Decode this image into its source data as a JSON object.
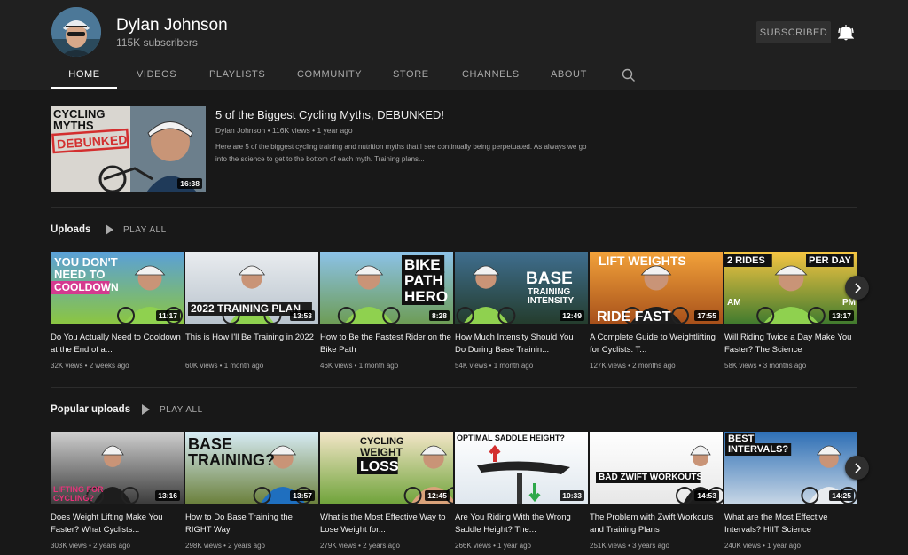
{
  "channel": {
    "name": "Dylan Johnson",
    "subscribers": "115K subscribers",
    "subscribe_label": "SUBSCRIBED"
  },
  "tabs": [
    "HOME",
    "VIDEOS",
    "PLAYLISTS",
    "COMMUNITY",
    "STORE",
    "CHANNELS",
    "ABOUT"
  ],
  "featured": {
    "title": "5 of the Biggest Cycling Myths, DEBUNKED!",
    "meta": "Dylan Johnson • 116K views • 1 year ago",
    "description": "Here are 5 of the biggest cycling training and nutrition myths that I see continually being perpetuated. As always we go into the science to get to the bottom of each myth. Training plans...",
    "duration": "16:38",
    "thumb_text": [
      "CYCLING",
      "MYTHS",
      "DEBUNKED"
    ]
  },
  "uploads": {
    "title": "Uploads",
    "play_all": "PLAY ALL",
    "videos": [
      {
        "title": "Do You Actually Need to Cooldown at the End of a...",
        "meta": "32K views • 2 weeks ago",
        "duration": "11:17",
        "thumb_text": [
          "YOU DON'T",
          "NEED TO",
          "COOLDOWN"
        ]
      },
      {
        "title": "This is How I'll Be Training in 2022",
        "meta": "60K views • 1 month ago",
        "duration": "13:53",
        "thumb_text": [
          "2022 TRAINING PLAN"
        ]
      },
      {
        "title": "How to Be the Fastest Rider on the Bike Path",
        "meta": "46K views • 1 month ago",
        "duration": "8:28",
        "thumb_text": [
          "BIKE",
          "PATH",
          "HERO"
        ]
      },
      {
        "title": "How Much Intensity Should You Do During Base Trainin...",
        "meta": "54K views • 1 month ago",
        "duration": "12:49",
        "thumb_text": [
          "BASE",
          "TRAINING",
          "INTENSITY"
        ]
      },
      {
        "title": "A Complete Guide to Weightlifting for Cyclists. T...",
        "meta": "127K views • 2 months ago",
        "duration": "17:55",
        "thumb_text": [
          "LIFT WEIGHTS",
          "RIDE FAST"
        ]
      },
      {
        "title": "Will Riding Twice a Day Make You Faster? The Science",
        "meta": "58K views • 3 months ago",
        "duration": "13:17",
        "thumb_text": [
          "2 RIDES",
          "PER DAY",
          "AM",
          "PM"
        ]
      }
    ]
  },
  "popular": {
    "title": "Popular uploads",
    "play_all": "PLAY ALL",
    "videos": [
      {
        "title": "Does Weight Lifting Make You Faster? What Cyclists...",
        "meta": "303K views • 2 years ago",
        "duration": "13:16",
        "thumb_text": [
          "LIFTING FOR",
          "CYCLING?"
        ]
      },
      {
        "title": "How to Do Base Training the RIGHT Way",
        "meta": "298K views • 2 years ago",
        "duration": "13:57",
        "thumb_text": [
          "BASE",
          "TRAINING?"
        ]
      },
      {
        "title": "What is the Most Effective Way to Lose Weight for...",
        "meta": "279K views • 2 years ago",
        "duration": "12:45",
        "thumb_text": [
          "CYCLING",
          "WEIGHT",
          "LOSS"
        ]
      },
      {
        "title": "Are You Riding With the Wrong Saddle Height? The...",
        "meta": "266K views • 1 year ago",
        "duration": "10:33",
        "thumb_text": [
          "OPTIMAL SADDLE HEIGHT?"
        ]
      },
      {
        "title": "The Problem with Zwift Workouts and Training Plans",
        "meta": "251K views • 3 years ago",
        "duration": "14:53",
        "thumb_text": [
          "BAD ZWIFT WORKOUTS"
        ]
      },
      {
        "title": "What are the Most Effective Intervals? HIIT Science",
        "meta": "240K views • 1 year ago",
        "duration": "14:25",
        "thumb_text": [
          "BEST",
          "INTERVALS?"
        ]
      }
    ]
  },
  "icons": {
    "bell": "bell-icon",
    "search": "search-icon",
    "next": "chevron-right-icon",
    "play": "play-icon"
  }
}
